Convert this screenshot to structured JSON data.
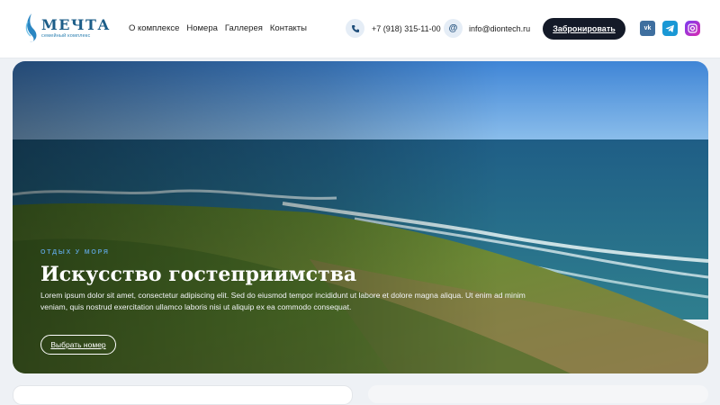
{
  "brand": {
    "name": "МЕЧТА",
    "tagline": "семейный комплекс"
  },
  "nav": {
    "items": [
      "О комплексе",
      "Номера",
      "Галлерея",
      "Контакты"
    ]
  },
  "contacts": {
    "phone": "+7 (918) 315-11-00",
    "email": "info@diontech.ru"
  },
  "header": {
    "book_label": "Забронировать"
  },
  "social": [
    "vk-icon",
    "telegram-icon",
    "instagram-icon"
  ],
  "hero": {
    "eyebrow": "Отдых у моря",
    "title": "Искусство гостеприимства",
    "description": "Lorem ipsum dolor sit amet, consectetur adipiscing elit. Sed do eiusmod tempor incididunt ut labore et dolore magna aliqua. Ut enim ad minim veniam, quis nostrud exercitation ullamco laboris nisi ut aliquip ex ea commodo consequat.",
    "button_label": "Выбрать номер"
  },
  "colors": {
    "accent_dark": "#141a28",
    "brand_blue": "#1c5d88",
    "eyebrow_blue": "#5a9bc9"
  }
}
